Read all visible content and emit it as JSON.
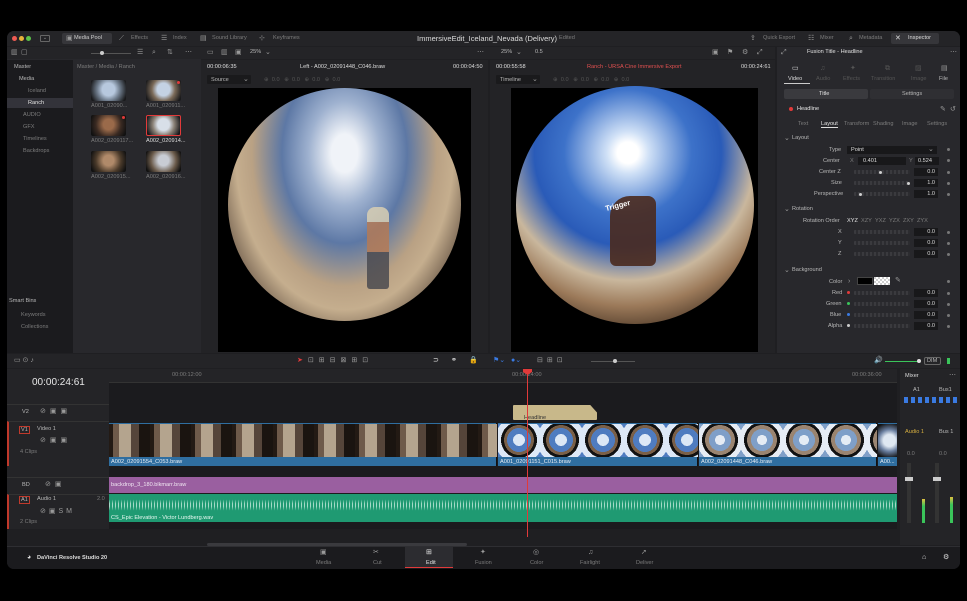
{
  "window": {
    "title": "ImmersiveEdit_Iceland_Nevada (Delivery)",
    "status": "Edited"
  },
  "topbar": {
    "left": [
      "Media Pool",
      "Effects",
      "Index",
      "Sound Library",
      "Keyframes"
    ],
    "right": [
      "Quick Export",
      "Mixer",
      "Metadata",
      "Inspector"
    ]
  },
  "mediapool": {
    "zoom": "25%",
    "tree": [
      "Master",
      "Media",
      "Iceland",
      "Ranch",
      "AUDIO",
      "GFX",
      "Timelines",
      "Backdrops"
    ],
    "breadcrumb": "Master / Media / Ranch",
    "smartbins_title": "Smart Bins",
    "smartbins": [
      "Keywords",
      "Collections"
    ],
    "clips": [
      "A001_02090...",
      "A001_020911...",
      "A002_0209117...",
      "A002_020914...",
      "A002_020915...",
      "A002_020916..."
    ]
  },
  "source": {
    "timecode": "00:00:06:35",
    "title": "Left - A002_02091448_C046.braw",
    "duration": "00:00:04:50",
    "mode": "Source"
  },
  "timelineviewer": {
    "zoom": "25%",
    "timecode": "00:00:55:58",
    "title": "Ranch - URSA Cine Immersive Export",
    "duration": "00:00:24:61",
    "mode": "Timeline",
    "zoomval": "0.5",
    "overlay": "Trigger"
  },
  "inspector": {
    "title": "Fusion Title - Headline",
    "tabs": [
      "Video",
      "Audio",
      "Effects",
      "Transition",
      "Image",
      "File"
    ],
    "subtabs": [
      "Title",
      "Settings"
    ],
    "node": "Headline",
    "nodetabs": [
      "Text",
      "Layout",
      "Transform",
      "Shading",
      "Image",
      "Settings"
    ],
    "layout": {
      "label": "Layout",
      "type_label": "Type",
      "type_value": "Point",
      "center_label": "Center",
      "center_x_label": "X",
      "center_x": "0.401",
      "center_y_label": "Y",
      "center_y": "0.524",
      "centerz_label": "Center Z",
      "centerz": "0.0",
      "size_label": "Size",
      "size": "1.0",
      "perspective_label": "Perspective",
      "perspective": "1.0"
    },
    "rotation": {
      "label": "Rotation",
      "order_label": "Rotation Order",
      "orders": [
        "XYZ",
        "XZY",
        "YXZ",
        "YZX",
        "ZXY",
        "ZYX"
      ],
      "x_label": "X",
      "x": "0.0",
      "y_label": "Y",
      "y": "0.0",
      "z_label": "Z",
      "z": "0.0"
    },
    "background": {
      "label": "Background",
      "color_label": "Color",
      "red_label": "Red",
      "red": "0.0",
      "green_label": "Green",
      "green": "0.0",
      "blue_label": "Blue",
      "blue": "0.0",
      "alpha_label": "Alpha",
      "alpha": "0.0"
    }
  },
  "timeline": {
    "timecode": "00:00:24:61",
    "ruler": [
      "00:00:12:00",
      "00:00:24:00",
      "00:00:36:00"
    ],
    "dim": "DIM",
    "tracks": {
      "v2": "V2",
      "v1": "V1",
      "v1_name": "Video 1",
      "v1_clips": "4 Clips",
      "bd": "BD",
      "a1": "A1",
      "a1_name": "Audio 1",
      "a1_ch": "2.0",
      "a1_clips": "2 Clips"
    },
    "clips": {
      "title": "Headline",
      "video1": "A002_02091554_C053.braw",
      "video2": "A001_02091151_C015.braw",
      "video3": "A002_02091448_C046.braw",
      "video4": "A00...",
      "backdrop": "backdrop_3_180.blkmarr.braw",
      "audio": "CS_Epic Elevation - Victor Lundberg.wav"
    }
  },
  "mixer": {
    "title": "Mixer",
    "cols": [
      "A1",
      "Bus1"
    ],
    "labels": [
      "Audio 1",
      "Bus 1"
    ],
    "db": [
      "0.0",
      "0.0"
    ]
  },
  "pages": {
    "app": "DaVinci Resolve Studio 20",
    "items": [
      "Media",
      "Cut",
      "Edit",
      "Fusion",
      "Color",
      "Fairlight",
      "Deliver"
    ],
    "active": "Edit"
  },
  "colors": {
    "accent": "#e13a3a",
    "video_clip": "#2f6ea0",
    "fusion_clip": "#c8b88a",
    "backdrop_clip": "#9a5fa0",
    "audio_clip": "#1f9a72",
    "page_active": "#e13a3a"
  }
}
